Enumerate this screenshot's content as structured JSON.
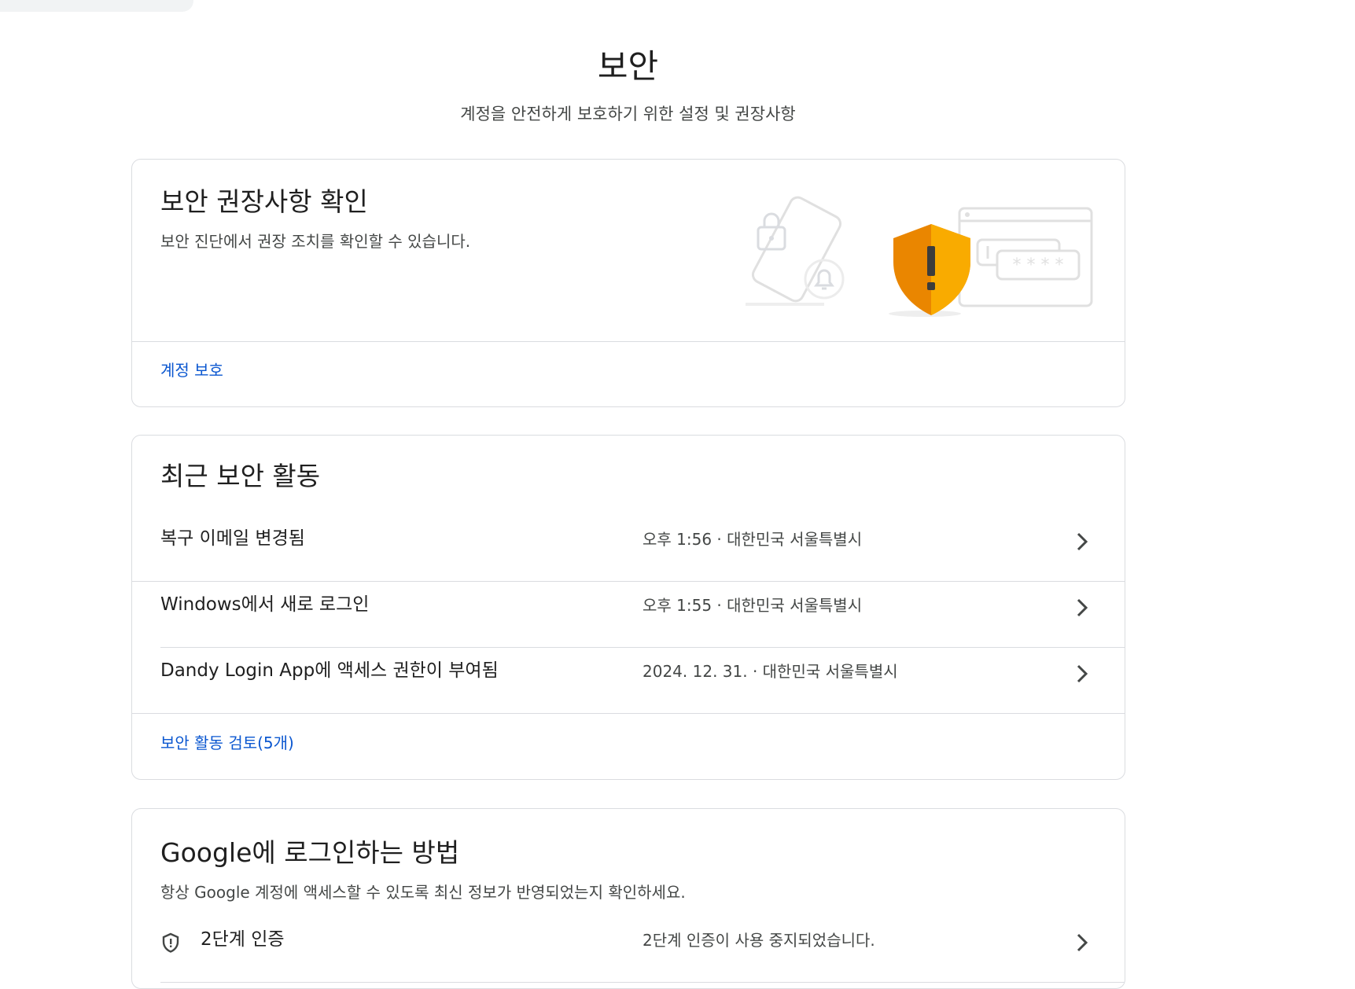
{
  "header": {
    "title": "보안",
    "subtitle": "계정을 안전하게 보호하기 위한 설정 및 권장사항"
  },
  "recommendations_card": {
    "title": "보안 권장사항 확인",
    "description": "보안 진단에서 권장 조치를 확인할 수 있습니다.",
    "illustration_password_mask": "* * * *",
    "link": "계정 보호"
  },
  "recent_activity_card": {
    "title": "최근 보안 활동",
    "items": [
      {
        "label": "복구 이메일 변경됨",
        "detail": "오후 1:56 · 대한민국 서울특별시"
      },
      {
        "label": "Windows에서 새로 로그인",
        "detail": "오후 1:55 · 대한민국 서울특별시"
      },
      {
        "label": "Dandy Login App에 액세스 권한이 부여됨",
        "detail": "2024. 12. 31. · 대한민국 서울특별시"
      }
    ],
    "link": "보안 활동 검토(5개)"
  },
  "signin_card": {
    "title": "Google에 로그인하는 방법",
    "description": "항상 Google 계정에 액세스할 수 있도록 최신 정보가 반영되었는지 확인하세요.",
    "items": [
      {
        "icon": "shield-icon",
        "label": "2단계 인증",
        "detail": "2단계 인증이 사용 중지되었습니다."
      }
    ]
  },
  "colors": {
    "link": "#0b57d0",
    "shield_primary": "#f9ab00",
    "shield_dark": "#ea8600",
    "border": "#dadce0"
  }
}
